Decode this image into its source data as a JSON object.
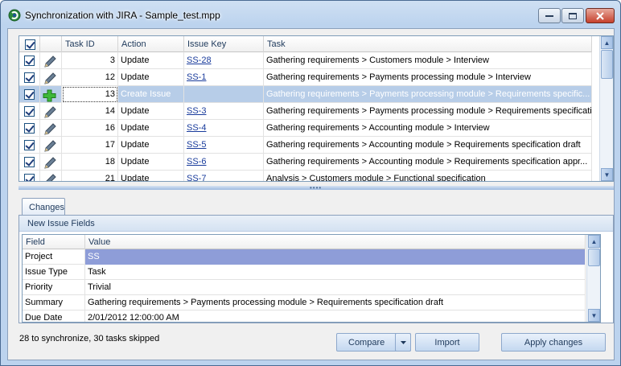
{
  "window": {
    "title": "Synchronization with JIRA - Sample_test.mpp"
  },
  "grid": {
    "columns": [
      "Task ID",
      "Action",
      "Issue Key",
      "Task"
    ],
    "rows": [
      {
        "checked": true,
        "icon": "pencil-icon",
        "task_id": "3",
        "action": "Update",
        "issue_key": "SS-28",
        "task": "Gathering requirements > Customers module > Interview"
      },
      {
        "checked": true,
        "icon": "pencil-icon",
        "task_id": "12",
        "action": "Update",
        "issue_key": "SS-1",
        "task": "Gathering requirements > Payments processing module > Interview"
      },
      {
        "checked": true,
        "icon": "plus-icon",
        "task_id": "13",
        "action": "Create Issue",
        "issue_key": "",
        "task": "Gathering requirements > Payments processing module > Requirements specific..."
      },
      {
        "checked": true,
        "icon": "pencil-icon",
        "task_id": "14",
        "action": "Update",
        "issue_key": "SS-3",
        "task": "Gathering requirements > Payments processing module > Requirements specificatio..."
      },
      {
        "checked": true,
        "icon": "pencil-icon",
        "task_id": "16",
        "action": "Update",
        "issue_key": "SS-4",
        "task": "Gathering requirements > Accounting module > Interview"
      },
      {
        "checked": true,
        "icon": "pencil-icon",
        "task_id": "17",
        "action": "Update",
        "issue_key": "SS-5",
        "task": "Gathering requirements > Accounting module > Requirements specification draft"
      },
      {
        "checked": true,
        "icon": "pencil-icon",
        "task_id": "18",
        "action": "Update",
        "issue_key": "SS-6",
        "task": "Gathering requirements > Accounting module > Requirements specification appr..."
      },
      {
        "checked": true,
        "icon": "pencil-icon",
        "task_id": "21",
        "action": "Update",
        "issue_key": "SS-7",
        "task": "Analysis > Customers module > Functional specification"
      }
    ]
  },
  "changes": {
    "tab_label": "Changes",
    "group_label": "New Issue Fields",
    "columns": [
      "Field",
      "Value"
    ],
    "rows": [
      {
        "field": "Project",
        "value": "SS"
      },
      {
        "field": "Issue Type",
        "value": "Task"
      },
      {
        "field": "Priority",
        "value": "Trivial"
      },
      {
        "field": "Summary",
        "value": "Gathering requirements > Payments processing module > Requirements specification draft"
      },
      {
        "field": "Due Date",
        "value": "2/01/2012 12:00:00 AM"
      }
    ]
  },
  "status_text": "28 to synchronize, 30 tasks skipped",
  "buttons": {
    "compare": "Compare",
    "import": "Import",
    "apply": "Apply changes"
  },
  "colors": {
    "selection": "#b7cde8",
    "value_selection": "#8e9dd8",
    "accent": "#1e395b"
  }
}
